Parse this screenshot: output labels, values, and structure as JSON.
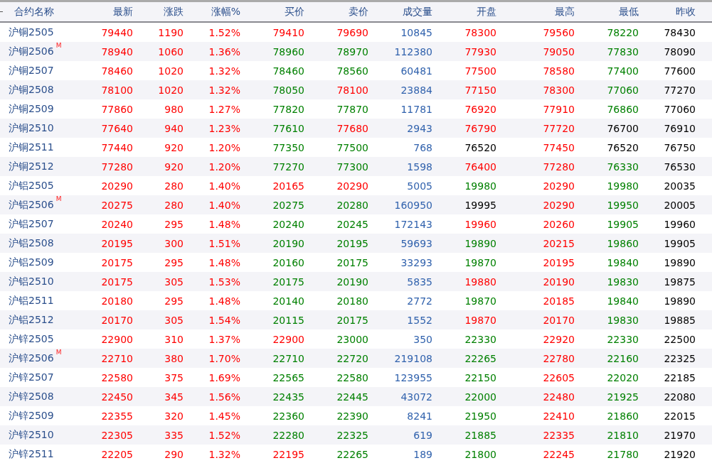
{
  "columns": [
    {
      "label": "合约名称",
      "kind": "name"
    },
    {
      "label": "最新",
      "kind": "price"
    },
    {
      "label": "涨跌",
      "kind": "price"
    },
    {
      "label": "涨幅%",
      "kind": "price"
    },
    {
      "label": "买价",
      "kind": "price"
    },
    {
      "label": "卖价",
      "kind": "price"
    },
    {
      "label": "成交量",
      "kind": "volume"
    },
    {
      "label": "开盘",
      "kind": "price"
    },
    {
      "label": "最高",
      "kind": "price"
    },
    {
      "label": "最低",
      "kind": "price"
    },
    {
      "label": "昨收",
      "kind": "close"
    }
  ],
  "rows": [
    {
      "name": "沪铜2505",
      "cells": [
        {
          "text": "79440",
          "color": "#ff0000"
        },
        {
          "text": "1190",
          "color": "#ff0000"
        },
        {
          "text": "1.52%",
          "color": "#ff0000"
        },
        {
          "text": "79410",
          "color": "#ff0000"
        },
        {
          "text": "79690",
          "color": "#ff0000"
        },
        {
          "text": "10845"
        },
        {
          "text": "78300",
          "color": "#ff0000"
        },
        {
          "text": "79560",
          "color": "#ff0000"
        },
        {
          "text": "78220",
          "color": "#008000"
        },
        {
          "text": "78430"
        }
      ]
    },
    {
      "name": "沪铜2506",
      "badge": "M",
      "cells": [
        {
          "text": "78940",
          "color": "#ff0000"
        },
        {
          "text": "1060",
          "color": "#ff0000"
        },
        {
          "text": "1.36%",
          "color": "#ff0000"
        },
        {
          "text": "78960",
          "color": "#008000"
        },
        {
          "text": "78970",
          "color": "#008000"
        },
        {
          "text": "112380"
        },
        {
          "text": "77930",
          "color": "#ff0000"
        },
        {
          "text": "79050",
          "color": "#ff0000"
        },
        {
          "text": "77830",
          "color": "#008000"
        },
        {
          "text": "78090"
        }
      ]
    },
    {
      "name": "沪铜2507",
      "cells": [
        {
          "text": "78460",
          "color": "#ff0000"
        },
        {
          "text": "1020",
          "color": "#ff0000"
        },
        {
          "text": "1.32%",
          "color": "#ff0000"
        },
        {
          "text": "78460",
          "color": "#008000"
        },
        {
          "text": "78560",
          "color": "#008000"
        },
        {
          "text": "60481"
        },
        {
          "text": "77500",
          "color": "#ff0000"
        },
        {
          "text": "78580",
          "color": "#ff0000"
        },
        {
          "text": "77400",
          "color": "#008000"
        },
        {
          "text": "77600"
        }
      ]
    },
    {
      "name": "沪铜2508",
      "cells": [
        {
          "text": "78100",
          "color": "#ff0000"
        },
        {
          "text": "1020",
          "color": "#ff0000"
        },
        {
          "text": "1.32%",
          "color": "#ff0000"
        },
        {
          "text": "78050",
          "color": "#008000"
        },
        {
          "text": "78100",
          "color": "#ff0000"
        },
        {
          "text": "23884"
        },
        {
          "text": "77150",
          "color": "#ff0000"
        },
        {
          "text": "78300",
          "color": "#ff0000"
        },
        {
          "text": "77060",
          "color": "#008000"
        },
        {
          "text": "77270"
        }
      ]
    },
    {
      "name": "沪铜2509",
      "cells": [
        {
          "text": "77860",
          "color": "#ff0000"
        },
        {
          "text": "980",
          "color": "#ff0000"
        },
        {
          "text": "1.27%",
          "color": "#ff0000"
        },
        {
          "text": "77820",
          "color": "#008000"
        },
        {
          "text": "77870",
          "color": "#008000"
        },
        {
          "text": "11781"
        },
        {
          "text": "76920",
          "color": "#ff0000"
        },
        {
          "text": "77910",
          "color": "#ff0000"
        },
        {
          "text": "76860",
          "color": "#008000"
        },
        {
          "text": "77060"
        }
      ]
    },
    {
      "name": "沪铜2510",
      "cells": [
        {
          "text": "77640",
          "color": "#ff0000"
        },
        {
          "text": "940",
          "color": "#ff0000"
        },
        {
          "text": "1.23%",
          "color": "#ff0000"
        },
        {
          "text": "77610",
          "color": "#008000"
        },
        {
          "text": "77680",
          "color": "#ff0000"
        },
        {
          "text": "2943"
        },
        {
          "text": "76790",
          "color": "#ff0000"
        },
        {
          "text": "77720",
          "color": "#ff0000"
        },
        {
          "text": "76700",
          "color": "#000000"
        },
        {
          "text": "76910"
        }
      ]
    },
    {
      "name": "沪铜2511",
      "cells": [
        {
          "text": "77440",
          "color": "#ff0000"
        },
        {
          "text": "920",
          "color": "#ff0000"
        },
        {
          "text": "1.20%",
          "color": "#ff0000"
        },
        {
          "text": "77350",
          "color": "#008000"
        },
        {
          "text": "77500",
          "color": "#008000"
        },
        {
          "text": "768"
        },
        {
          "text": "76520",
          "color": "#000000"
        },
        {
          "text": "77450",
          "color": "#ff0000"
        },
        {
          "text": "76520",
          "color": "#000000"
        },
        {
          "text": "76750"
        }
      ]
    },
    {
      "name": "沪铜2512",
      "cells": [
        {
          "text": "77280",
          "color": "#ff0000"
        },
        {
          "text": "920",
          "color": "#ff0000"
        },
        {
          "text": "1.20%",
          "color": "#ff0000"
        },
        {
          "text": "77270",
          "color": "#008000"
        },
        {
          "text": "77300",
          "color": "#008000"
        },
        {
          "text": "1598"
        },
        {
          "text": "76400",
          "color": "#ff0000"
        },
        {
          "text": "77280",
          "color": "#ff0000"
        },
        {
          "text": "76330",
          "color": "#008000"
        },
        {
          "text": "76530"
        }
      ]
    },
    {
      "name": "沪铝2505",
      "cells": [
        {
          "text": "20290",
          "color": "#ff0000"
        },
        {
          "text": "280",
          "color": "#ff0000"
        },
        {
          "text": "1.40%",
          "color": "#ff0000"
        },
        {
          "text": "20165",
          "color": "#ff0000"
        },
        {
          "text": "20290",
          "color": "#ff0000"
        },
        {
          "text": "5005"
        },
        {
          "text": "19980",
          "color": "#008000"
        },
        {
          "text": "20290",
          "color": "#ff0000"
        },
        {
          "text": "19980",
          "color": "#008000"
        },
        {
          "text": "20035"
        }
      ]
    },
    {
      "name": "沪铝2506",
      "badge": "M",
      "cells": [
        {
          "text": "20275",
          "color": "#ff0000"
        },
        {
          "text": "280",
          "color": "#ff0000"
        },
        {
          "text": "1.40%",
          "color": "#ff0000"
        },
        {
          "text": "20275",
          "color": "#008000"
        },
        {
          "text": "20280",
          "color": "#008000"
        },
        {
          "text": "160950"
        },
        {
          "text": "19995",
          "color": "#000000"
        },
        {
          "text": "20290",
          "color": "#ff0000"
        },
        {
          "text": "19950",
          "color": "#008000"
        },
        {
          "text": "20005"
        }
      ]
    },
    {
      "name": "沪铝2507",
      "cells": [
        {
          "text": "20240",
          "color": "#ff0000"
        },
        {
          "text": "295",
          "color": "#ff0000"
        },
        {
          "text": "1.48%",
          "color": "#ff0000"
        },
        {
          "text": "20240",
          "color": "#008000"
        },
        {
          "text": "20245",
          "color": "#008000"
        },
        {
          "text": "172143"
        },
        {
          "text": "19960",
          "color": "#ff0000"
        },
        {
          "text": "20260",
          "color": "#ff0000"
        },
        {
          "text": "19905",
          "color": "#008000"
        },
        {
          "text": "19960"
        }
      ]
    },
    {
      "name": "沪铝2508",
      "cells": [
        {
          "text": "20195",
          "color": "#ff0000"
        },
        {
          "text": "300",
          "color": "#ff0000"
        },
        {
          "text": "1.51%",
          "color": "#ff0000"
        },
        {
          "text": "20190",
          "color": "#008000"
        },
        {
          "text": "20195",
          "color": "#008000"
        },
        {
          "text": "59693"
        },
        {
          "text": "19890",
          "color": "#008000"
        },
        {
          "text": "20215",
          "color": "#ff0000"
        },
        {
          "text": "19860",
          "color": "#008000"
        },
        {
          "text": "19905"
        }
      ]
    },
    {
      "name": "沪铝2509",
      "cells": [
        {
          "text": "20175",
          "color": "#ff0000"
        },
        {
          "text": "295",
          "color": "#ff0000"
        },
        {
          "text": "1.48%",
          "color": "#ff0000"
        },
        {
          "text": "20160",
          "color": "#008000"
        },
        {
          "text": "20175",
          "color": "#008000"
        },
        {
          "text": "33293"
        },
        {
          "text": "19870",
          "color": "#008000"
        },
        {
          "text": "20195",
          "color": "#ff0000"
        },
        {
          "text": "19840",
          "color": "#008000"
        },
        {
          "text": "19890"
        }
      ]
    },
    {
      "name": "沪铝2510",
      "cells": [
        {
          "text": "20175",
          "color": "#ff0000"
        },
        {
          "text": "305",
          "color": "#ff0000"
        },
        {
          "text": "1.53%",
          "color": "#ff0000"
        },
        {
          "text": "20175",
          "color": "#008000"
        },
        {
          "text": "20190",
          "color": "#008000"
        },
        {
          "text": "5835"
        },
        {
          "text": "19880",
          "color": "#ff0000"
        },
        {
          "text": "20190",
          "color": "#ff0000"
        },
        {
          "text": "19830",
          "color": "#008000"
        },
        {
          "text": "19875"
        }
      ]
    },
    {
      "name": "沪铝2511",
      "cells": [
        {
          "text": "20180",
          "color": "#ff0000"
        },
        {
          "text": "295",
          "color": "#ff0000"
        },
        {
          "text": "1.48%",
          "color": "#ff0000"
        },
        {
          "text": "20140",
          "color": "#008000"
        },
        {
          "text": "20180",
          "color": "#008000"
        },
        {
          "text": "2772"
        },
        {
          "text": "19870",
          "color": "#008000"
        },
        {
          "text": "20185",
          "color": "#ff0000"
        },
        {
          "text": "19840",
          "color": "#008000"
        },
        {
          "text": "19890"
        }
      ]
    },
    {
      "name": "沪铝2512",
      "cells": [
        {
          "text": "20170",
          "color": "#ff0000"
        },
        {
          "text": "305",
          "color": "#ff0000"
        },
        {
          "text": "1.54%",
          "color": "#ff0000"
        },
        {
          "text": "20115",
          "color": "#008000"
        },
        {
          "text": "20175",
          "color": "#008000"
        },
        {
          "text": "1552"
        },
        {
          "text": "19870",
          "color": "#ff0000"
        },
        {
          "text": "20170",
          "color": "#ff0000"
        },
        {
          "text": "19830",
          "color": "#008000"
        },
        {
          "text": "19885"
        }
      ]
    },
    {
      "name": "沪锌2505",
      "cells": [
        {
          "text": "22900",
          "color": "#ff0000"
        },
        {
          "text": "310",
          "color": "#ff0000"
        },
        {
          "text": "1.37%",
          "color": "#ff0000"
        },
        {
          "text": "22900",
          "color": "#ff0000"
        },
        {
          "text": "23000",
          "color": "#008000"
        },
        {
          "text": "350"
        },
        {
          "text": "22330",
          "color": "#008000"
        },
        {
          "text": "22920",
          "color": "#ff0000"
        },
        {
          "text": "22330",
          "color": "#008000"
        },
        {
          "text": "22500"
        }
      ]
    },
    {
      "name": "沪锌2506",
      "badge": "M",
      "cells": [
        {
          "text": "22710",
          "color": "#ff0000"
        },
        {
          "text": "380",
          "color": "#ff0000"
        },
        {
          "text": "1.70%",
          "color": "#ff0000"
        },
        {
          "text": "22710",
          "color": "#008000"
        },
        {
          "text": "22720",
          "color": "#008000"
        },
        {
          "text": "219108"
        },
        {
          "text": "22265",
          "color": "#008000"
        },
        {
          "text": "22780",
          "color": "#ff0000"
        },
        {
          "text": "22160",
          "color": "#008000"
        },
        {
          "text": "22325"
        }
      ]
    },
    {
      "name": "沪锌2507",
      "cells": [
        {
          "text": "22580",
          "color": "#ff0000"
        },
        {
          "text": "375",
          "color": "#ff0000"
        },
        {
          "text": "1.69%",
          "color": "#ff0000"
        },
        {
          "text": "22565",
          "color": "#008000"
        },
        {
          "text": "22580",
          "color": "#008000"
        },
        {
          "text": "123955"
        },
        {
          "text": "22150",
          "color": "#008000"
        },
        {
          "text": "22605",
          "color": "#ff0000"
        },
        {
          "text": "22020",
          "color": "#008000"
        },
        {
          "text": "22185"
        }
      ]
    },
    {
      "name": "沪锌2508",
      "cells": [
        {
          "text": "22450",
          "color": "#ff0000"
        },
        {
          "text": "345",
          "color": "#ff0000"
        },
        {
          "text": "1.56%",
          "color": "#ff0000"
        },
        {
          "text": "22435",
          "color": "#008000"
        },
        {
          "text": "22445",
          "color": "#008000"
        },
        {
          "text": "43072"
        },
        {
          "text": "22000",
          "color": "#008000"
        },
        {
          "text": "22480",
          "color": "#ff0000"
        },
        {
          "text": "21925",
          "color": "#008000"
        },
        {
          "text": "22080"
        }
      ]
    },
    {
      "name": "沪锌2509",
      "cells": [
        {
          "text": "22355",
          "color": "#ff0000"
        },
        {
          "text": "320",
          "color": "#ff0000"
        },
        {
          "text": "1.45%",
          "color": "#ff0000"
        },
        {
          "text": "22360",
          "color": "#008000"
        },
        {
          "text": "22390",
          "color": "#008000"
        },
        {
          "text": "8241"
        },
        {
          "text": "21950",
          "color": "#008000"
        },
        {
          "text": "22410",
          "color": "#ff0000"
        },
        {
          "text": "21860",
          "color": "#008000"
        },
        {
          "text": "22015"
        }
      ]
    },
    {
      "name": "沪锌2510",
      "cells": [
        {
          "text": "22305",
          "color": "#ff0000"
        },
        {
          "text": "335",
          "color": "#ff0000"
        },
        {
          "text": "1.52%",
          "color": "#ff0000"
        },
        {
          "text": "22280",
          "color": "#008000"
        },
        {
          "text": "22325",
          "color": "#008000"
        },
        {
          "text": "619"
        },
        {
          "text": "21885",
          "color": "#008000"
        },
        {
          "text": "22335",
          "color": "#ff0000"
        },
        {
          "text": "21810",
          "color": "#008000"
        },
        {
          "text": "21970"
        }
      ]
    },
    {
      "name": "沪锌2511",
      "cells": [
        {
          "text": "22205",
          "color": "#ff0000"
        },
        {
          "text": "290",
          "color": "#ff0000"
        },
        {
          "text": "1.32%",
          "color": "#ff0000"
        },
        {
          "text": "22195",
          "color": "#ff0000"
        },
        {
          "text": "22265",
          "color": "#008000"
        },
        {
          "text": "189"
        },
        {
          "text": "21800",
          "color": "#008000"
        },
        {
          "text": "22245",
          "color": "#ff0000"
        },
        {
          "text": "21780",
          "color": "#008000"
        },
        {
          "text": "21920"
        }
      ]
    }
  ]
}
